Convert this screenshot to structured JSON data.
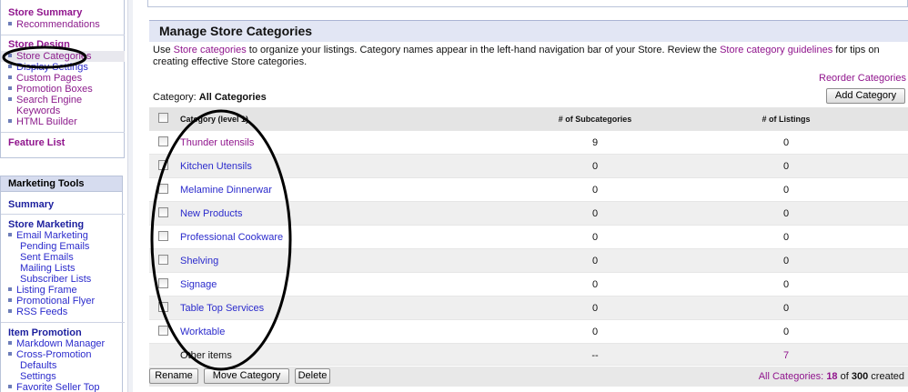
{
  "sidebar": {
    "store_summary": {
      "title": "Store Summary",
      "items": [
        "Recommendations"
      ]
    },
    "store_design": {
      "title": "Store Design",
      "items": [
        "Store Categories",
        "Display Settings",
        "Custom Pages",
        "Promotion Boxes",
        "Search Engine",
        "Keywords",
        "HTML Builder"
      ]
    },
    "feature_list": "Feature List",
    "marketing_tools": {
      "header": "Marketing Tools",
      "summary": "Summary",
      "store_marketing": "Store Marketing",
      "email_marketing": "Email Marketing",
      "email_sub": [
        "Pending Emails",
        "Sent Emails",
        "Mailing Lists",
        "Subscriber Lists"
      ],
      "items": [
        "Listing Frame",
        "Promotional Flyer",
        "RSS Feeds"
      ],
      "item_promotion": "Item Promotion",
      "promo_items": [
        "Markdown Manager",
        "Cross-Promotion"
      ],
      "cross_sub": [
        "Defaults",
        "Settings"
      ],
      "favorite": "Favorite Seller Top"
    }
  },
  "main": {
    "title": "Manage Store Categories",
    "desc_pre": "Use ",
    "desc_link1": "Store categories",
    "desc_mid": " to organize your listings. Category names appear in the left-hand navigation bar of your Store. Review the ",
    "desc_link2": "Store category guidelines",
    "desc_post": " for tips on creating effective Store categories.",
    "reorder": "Reorder Categories",
    "category_label": "Category: ",
    "category_value": "All Categories",
    "add_button": "Add Category",
    "table": {
      "col_name": "Category (level 1)",
      "col_sub": "# of Subcategories",
      "col_list": "# of Listings",
      "rows": [
        {
          "name": "Thunder utensils",
          "sub": "9",
          "listings": "0"
        },
        {
          "name": "Kitchen Utensils",
          "sub": "0",
          "listings": "0"
        },
        {
          "name": "Melamine Dinnerwar",
          "sub": "0",
          "listings": "0"
        },
        {
          "name": "New Products",
          "sub": "0",
          "listings": "0"
        },
        {
          "name": "Professional Cookware",
          "sub": "0",
          "listings": "0"
        },
        {
          "name": "Shelving",
          "sub": "0",
          "listings": "0"
        },
        {
          "name": "Signage",
          "sub": "0",
          "listings": "0"
        },
        {
          "name": "Table Top Services",
          "sub": "0",
          "listings": "0"
        },
        {
          "name": "Worktable",
          "sub": "0",
          "listings": "0"
        }
      ],
      "other": {
        "name": "Other items",
        "sub": "--",
        "listings": "7"
      }
    },
    "footer": {
      "rename": "Rename",
      "move": "Move Category",
      "delete": "Delete",
      "count_link": "All Categories:",
      "count_value": "18",
      "count_of": "of",
      "count_total": "300",
      "count_suffix": "created"
    }
  },
  "colors": {
    "link_blue": "#2b2bcc",
    "link_purple": "#90158d",
    "header_bg": "#e2e6f4"
  }
}
